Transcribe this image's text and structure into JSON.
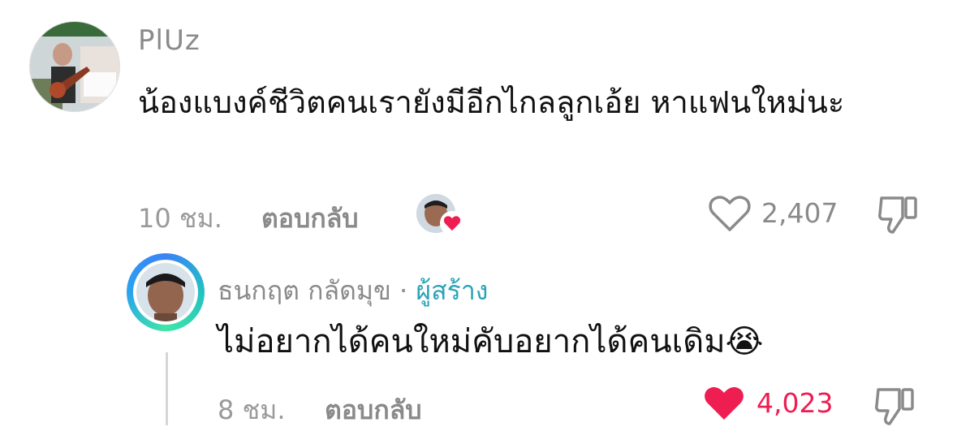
{
  "comment": {
    "username": "PlUz",
    "text": "น้องแบงค์ชีวิตคนเรายังมีอีกไกลลูกเอ้ย หาแฟนใหม่นะ",
    "time": "10 ชม.",
    "reply_label": "ตอบกลับ",
    "like_count": "2,407"
  },
  "reply": {
    "username": "ธนกฤต กลัดมุข",
    "separator": "·",
    "creator_label": "ผู้สร้าง",
    "text": "ไม่อยากได้คนใหม่คับอยากได้คนเดิม",
    "emoji": "😭",
    "time": "8 ชม.",
    "reply_label": "ตอบกลับ",
    "like_count": "4,023"
  },
  "colors": {
    "liked_heart": "#ee1d52",
    "creator_label": "#2aa3b8"
  }
}
